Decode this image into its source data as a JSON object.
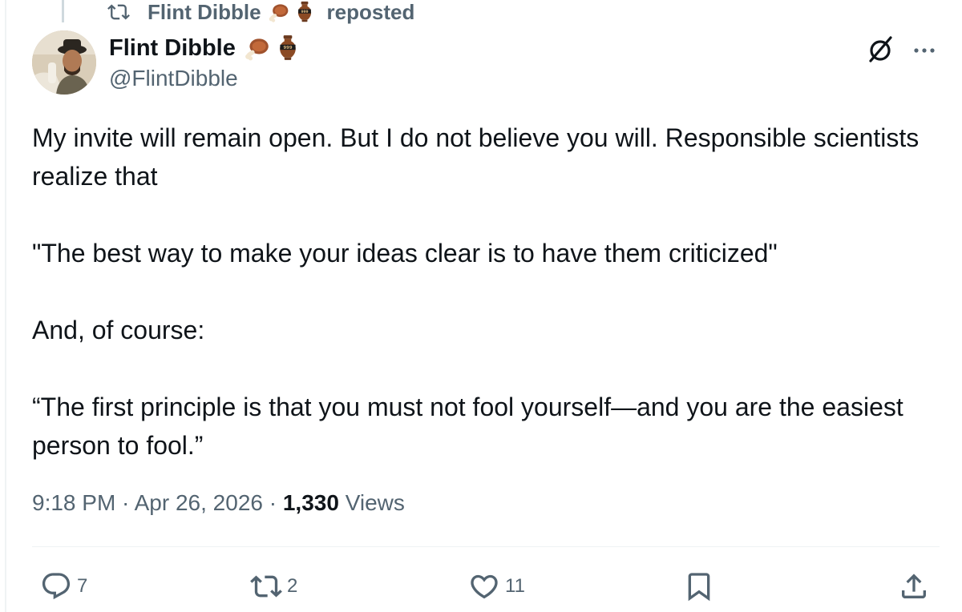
{
  "repost_header": {
    "name": "Flint Dibble",
    "label": "reposted",
    "icon": "repost-icon"
  },
  "author": {
    "display_name": "Flint Dibble",
    "handle": "@FlintDibble",
    "badges": [
      "meat-emoji",
      "amphora-emoji"
    ]
  },
  "tweet": {
    "paragraphs": [
      "My invite will remain open. But I do not believe you will. Responsible scientists realize that",
      "\"The best way to make your ideas clear is to have them criticized\"",
      "And, of course:",
      "“The first principle is that you must not fool yourself—and you are the easiest person to fool.”"
    ]
  },
  "meta": {
    "time": "9:18 PM",
    "separator": " · ",
    "date": "Apr 26, 2026",
    "views_count": "1,330",
    "views_label": " Views"
  },
  "actions": {
    "reply": {
      "icon": "reply-icon",
      "count": "7"
    },
    "repost": {
      "icon": "repost-icon",
      "count": "2"
    },
    "like": {
      "icon": "heart-icon",
      "count": "11"
    },
    "bookmark": {
      "icon": "bookmark-icon"
    },
    "share": {
      "icon": "share-icon"
    }
  },
  "top_icons": [
    "grok-icon",
    "more-icon"
  ],
  "colors": {
    "text": "#0f1419",
    "secondary": "#536471",
    "divider": "#eff3f4"
  }
}
